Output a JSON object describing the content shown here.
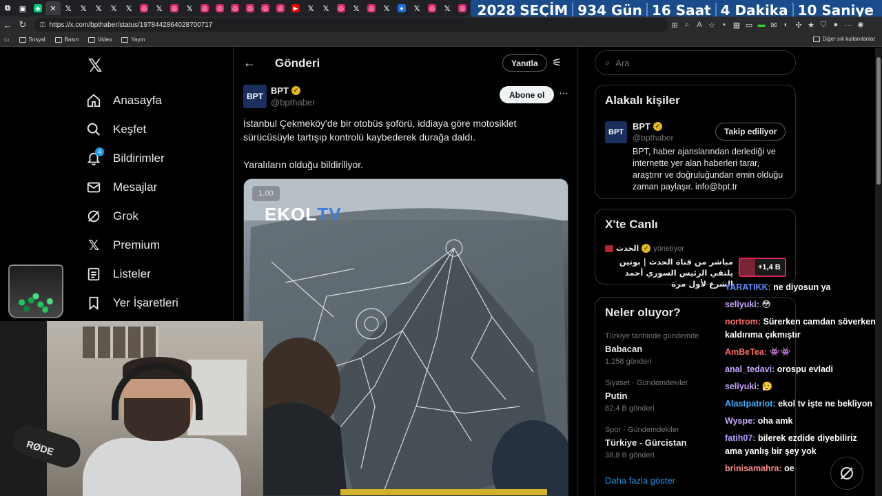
{
  "browser": {
    "url": "https://x.com/bpthaber/status/1978442864028700717",
    "bookmarks": [
      "Sosyal",
      "Basın",
      "Video",
      "Yayın"
    ],
    "bookmarks_right": "Diğer sık kullanılanlar"
  },
  "countdown": {
    "year": "2028",
    "label": "SEÇİM",
    "days": "934 Gün",
    "hours": "16 Saat",
    "minutes": "4 Dakika",
    "seconds": "10 Saniye"
  },
  "nav": {
    "items": [
      {
        "label": "Anasayfa",
        "icon": "home-icon"
      },
      {
        "label": "Keşfet",
        "icon": "search-icon"
      },
      {
        "label": "Bildirimler",
        "icon": "bell-icon",
        "badge": "4"
      },
      {
        "label": "Mesajlar",
        "icon": "mail-icon"
      },
      {
        "label": "Grok",
        "icon": "grok-icon"
      },
      {
        "label": "Premium",
        "icon": "x-icon"
      },
      {
        "label": "Listeler",
        "icon": "list-icon"
      },
      {
        "label": "Yer İşaretleri",
        "icon": "bookmark-icon"
      }
    ]
  },
  "post": {
    "header_title": "Gönderi",
    "reply_label": "Yanıtla",
    "author_name": "BPT",
    "author_handle": "@bpthaber",
    "avatar_text": "BPT",
    "follow_label": "Abone ol",
    "text_1": "İstanbul Çekmeköy'de bir otobüs şoförü, iddiaya göre motosiklet sürücüsüyle tartışıp kontrolü kaybederek durağa daldı.",
    "text_2": "Yaralıların olduğu bildiriliyor.",
    "media_speed": "1.00",
    "media_watermark_a": "EKOL",
    "media_watermark_b": "TV"
  },
  "sidebar": {
    "search_placeholder": "Ara",
    "related_title": "Alakalı kişiler",
    "related": {
      "name": "BPT",
      "handle": "@bpthaber",
      "avatar_text": "BPT",
      "button": "Takip ediliyor",
      "bio": "BPT, haber ajanslarından derlediği ve internette yer alan haberleri tarar, araştırır ve doğruluğundan emin olduğu zaman paylaşır. info@bpt.tr"
    },
    "live_title": "X'te Canlı",
    "live": {
      "host": "الحدث",
      "role": "yönetiyor",
      "text": "مباشر من قناة الحدث | بوتين يلتقي الرئيس السوري أحمد الشرع لأول مرة",
      "count": "+1,4 B"
    },
    "trends_title": "Neler oluyor?",
    "trends": [
      {
        "context": "Türkiye tarihinde gündemde",
        "title": "Babacan",
        "count": "1.258 gönderi"
      },
      {
        "context": "Siyaset · Gündemdekiler",
        "title": "Putin",
        "count": "82,4 B gönderi"
      },
      {
        "context": "Spor · Gündemdekiler",
        "title": "Türkiye - Gürcistan",
        "count": "38,8 B gönderi"
      }
    ],
    "show_more": "Daha fazla göster"
  },
  "webcam": {
    "mic_brand": "RØDE"
  },
  "chat": [
    {
      "user": "YARATIKK:",
      "text": "ne diyosun ya"
    },
    {
      "user": "seliyuki:",
      "text": "😳"
    },
    {
      "user": "nortrom:",
      "text": "Sürerken camdan söverken kaldırıma çıkmıştır"
    },
    {
      "user": "AmBeTea:",
      "text": "👾👾"
    },
    {
      "user": "anal_tedavi:",
      "text": "orospu evladi"
    },
    {
      "user": "seliyuki:",
      "text": "😮‍💨"
    },
    {
      "user": "Alastpatriot:",
      "text": "ekol tv işte ne bekliyon"
    },
    {
      "user": "Wyspe:",
      "text": "oha amk"
    },
    {
      "user": "fatih07:",
      "text": "bilerek ezdide diyebiliriz ama yanlış bir şey yok"
    },
    {
      "user": "brinisamahra:",
      "text": "oe"
    }
  ],
  "colors": {
    "accent": "#1d9bf0",
    "verified": "#e2b719",
    "countdown_bg": "#1a4c8c"
  }
}
